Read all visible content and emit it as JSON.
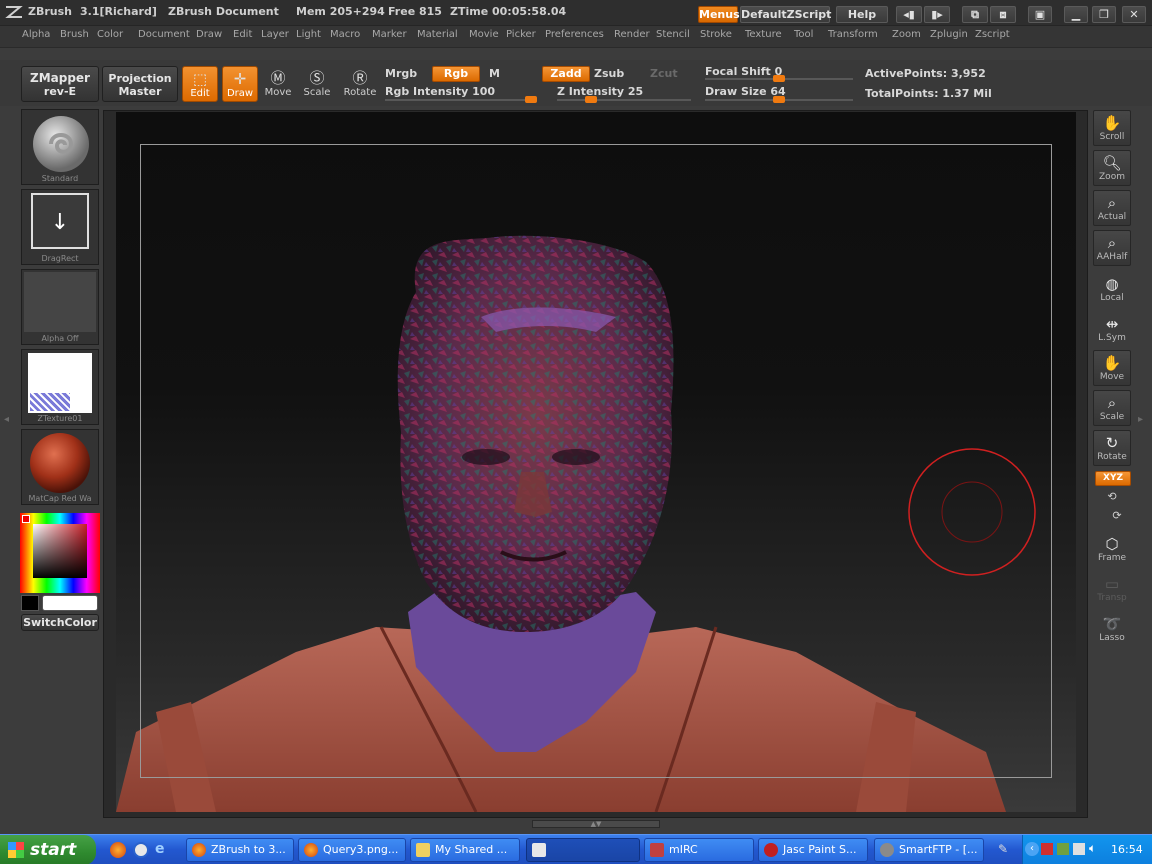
{
  "titlebar": {
    "app_name": "ZBrush",
    "version_user": "3.1[Richard]",
    "document": "ZBrush Document",
    "mem": "Mem 205+294",
    "free": "Free 815",
    "ztime": "ZTime 00:05:58.04",
    "menus_btn": "Menus",
    "zscript_btn": "DefaultZScript",
    "help_btn": "Help"
  },
  "menubar": [
    "Alpha",
    "Brush",
    "Color",
    "Document",
    "Draw",
    "Edit",
    "Layer",
    "Light",
    "Macro",
    "Marker",
    "Material",
    "Movie",
    "Picker",
    "Preferences",
    "Render",
    "Stencil",
    "Stroke",
    "Texture",
    "Tool",
    "Transform",
    "Zoom",
    "Zplugin",
    "Zscript"
  ],
  "toolbar": {
    "zmapper": "ZMapper",
    "zmapper_sub": "rev-E",
    "projection": "Projection",
    "projection_sub": "Master",
    "edit": "Edit",
    "draw": "Draw",
    "move": "Move",
    "scale": "Scale",
    "rotate": "Rotate",
    "mrgb": "Mrgb",
    "rgb": "Rgb",
    "m": "M",
    "zadd": "Zadd",
    "zsub": "Zsub",
    "zcut": "Zcut",
    "rgb_intensity": "Rgb Intensity 100",
    "z_intensity": "Z Intensity 25",
    "focal_shift": "Focal Shift 0",
    "draw_size": "Draw Size 64",
    "active_points": "ActivePoints: 3,952",
    "total_points": "TotalPoints: 1.37 Mil",
    "rgb_intensity_value": 100,
    "z_intensity_value": 25,
    "focal_shift_value": 0,
    "draw_size_value": 64
  },
  "left_shelf": {
    "brush": "Standard",
    "stroke": "DragRect",
    "alpha": "Alpha Off",
    "texture": "ZTexture01",
    "material": "MatCap Red Wa",
    "switch_color": "SwitchColor"
  },
  "right_shelf": [
    "Scroll",
    "Zoom",
    "Actual",
    "AAHalf",
    "Local",
    "L.Sym",
    "Move",
    "Scale",
    "Rotate",
    "XYZ",
    "Frame",
    "Transp",
    "Lasso"
  ],
  "taskbar": {
    "start": "start",
    "tasks": [
      "ZBrush to 3...",
      "Query3.png...",
      "My Shared ...",
      "",
      "mIRC",
      "Jasc Paint S...",
      "SmartFTP - [..."
    ],
    "clock": "16:54"
  },
  "colors": {
    "accent": "#e87a10",
    "taskbar": "#2358d0",
    "start": "#3a9a3a"
  }
}
